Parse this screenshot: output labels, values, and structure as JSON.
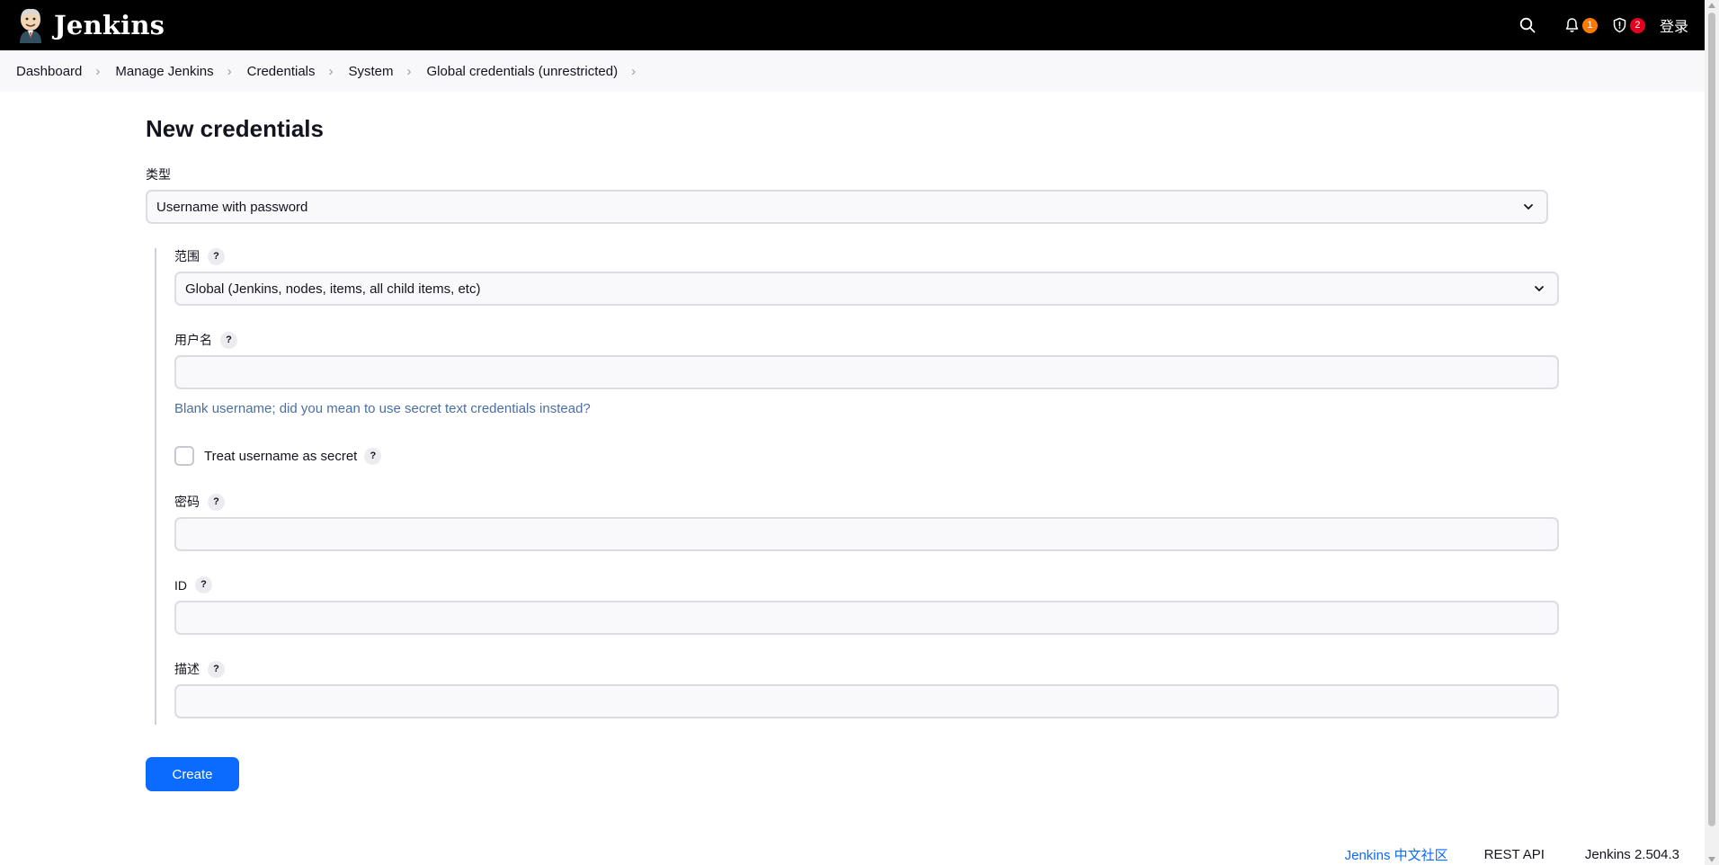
{
  "header": {
    "brand_name": "Jenkins",
    "notifications_count": "1",
    "security_count": "2",
    "login_label": "登录",
    "icons": [
      "search-icon",
      "bell-icon",
      "shield-icon"
    ],
    "colors": {
      "background": "#000000",
      "notification_badge": "#ff7a00",
      "security_badge": "#e6001f"
    }
  },
  "breadcrumb": {
    "items": [
      "Dashboard",
      "Manage Jenkins",
      "Credentials",
      "System",
      "Global credentials (unrestricted)"
    ]
  },
  "form": {
    "title": "New credentials",
    "kind_label": "类型",
    "kind_value": "Username with password",
    "scope_label": "范围",
    "scope_value": "Global (Jenkins, nodes, items, all child items, etc)",
    "username_label": "用户名",
    "username_value": "",
    "username_hint": "Blank username; did you mean to use secret text credentials instead?",
    "username_secret_label": "Treat username as secret",
    "username_secret_checked": false,
    "password_label": "密码",
    "password_value": "",
    "id_label": "ID",
    "id_value": "",
    "description_label": "描述",
    "description_value": "",
    "help_glyph": "?",
    "create_label": "Create",
    "accent_color": "#0b6bff"
  },
  "footer": {
    "community_link": "Jenkins 中文社区",
    "rest_api_link": "REST API",
    "version": "Jenkins 2.504.3"
  }
}
